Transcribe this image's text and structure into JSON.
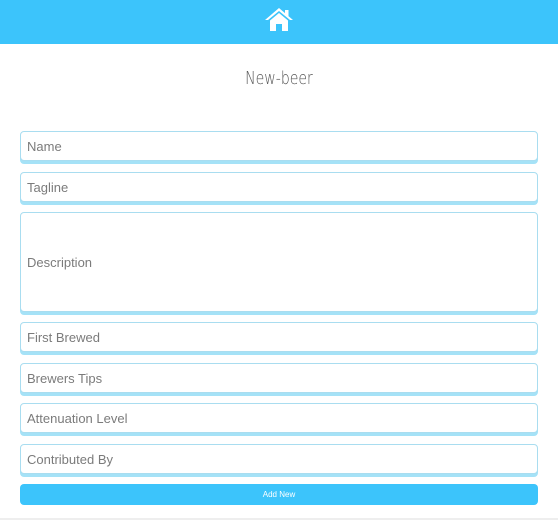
{
  "header": {
    "home_icon": "home-icon",
    "accent_color": "#3cc4fb"
  },
  "page": {
    "title": "New-beer"
  },
  "form": {
    "name_placeholder": "Name",
    "tagline_placeholder": "Tagline",
    "description_placeholder": "Description",
    "first_brewed_placeholder": "First Brewed",
    "brewers_tips_placeholder": "Brewers Tips",
    "attenuation_level_placeholder": "Attenuation Level",
    "contributed_by_placeholder": "Contributed By",
    "submit_label": "Add New"
  }
}
